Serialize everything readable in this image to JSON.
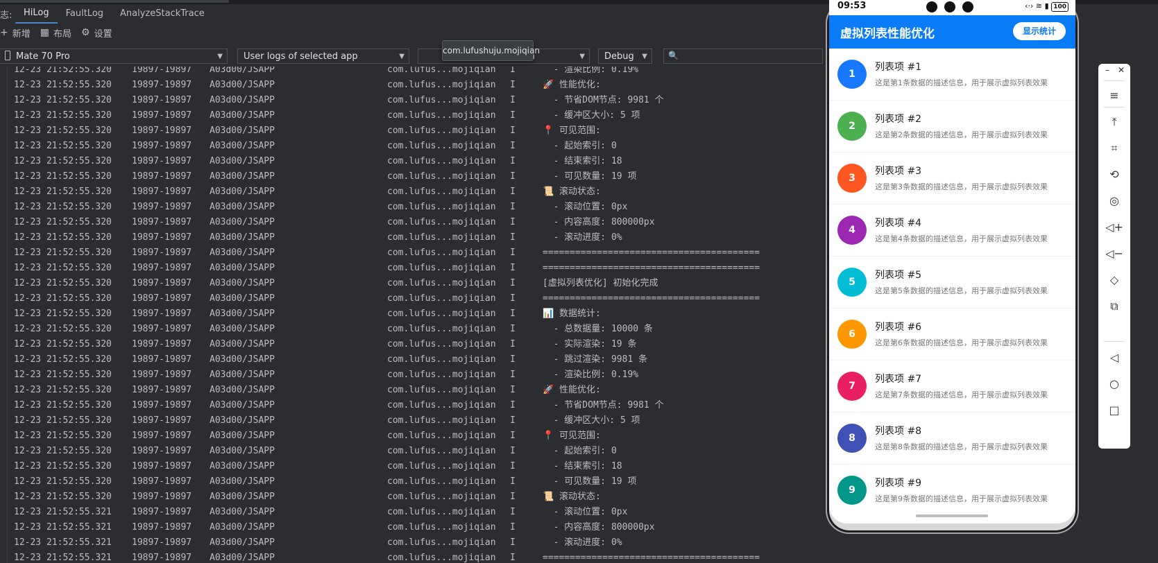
{
  "tabs": {
    "prefix": "志:",
    "items": [
      {
        "label": "HiLog",
        "active": true
      },
      {
        "label": "FaultLog",
        "active": false
      },
      {
        "label": "AnalyzeStackTrace",
        "active": false
      }
    ]
  },
  "toolbar": {
    "new_label": "新增",
    "layout_label": "布局",
    "settings_label": "设置"
  },
  "filters": {
    "device": "Mate 70 Pro",
    "log_scope": "User logs of selected app",
    "package": "com.lufushuju.mojiqian",
    "package_visible": "qian",
    "level": "Debug",
    "search_placeholder": ""
  },
  "tooltip": "com.lufushuju.mojiqian",
  "log": {
    "rows": [
      {
        "time": "12-23 21:52:55.320",
        "pid": "19897-19897",
        "tag": "A03d00/JSAPP",
        "pkg": "com.lufus...mojiqian",
        "lvl": "I",
        "msg": "  - 渲染比例: 0.19%"
      },
      {
        "time": "12-23 21:52:55.320",
        "pid": "19897-19897",
        "tag": "A03d00/JSAPP",
        "pkg": "com.lufus...mojiqian",
        "lvl": "I",
        "msg": "🚀 性能优化:"
      },
      {
        "time": "12-23 21:52:55.320",
        "pid": "19897-19897",
        "tag": "A03d00/JSAPP",
        "pkg": "com.lufus...mojiqian",
        "lvl": "I",
        "msg": "  - 节省DOM节点: 9981 个"
      },
      {
        "time": "12-23 21:52:55.320",
        "pid": "19897-19897",
        "tag": "A03d00/JSAPP",
        "pkg": "com.lufus...mojiqian",
        "lvl": "I",
        "msg": "  - 缓冲区大小: 5 项"
      },
      {
        "time": "12-23 21:52:55.320",
        "pid": "19897-19897",
        "tag": "A03d00/JSAPP",
        "pkg": "com.lufus...mojiqian",
        "lvl": "I",
        "msg": "📍 可见范围:"
      },
      {
        "time": "12-23 21:52:55.320",
        "pid": "19897-19897",
        "tag": "A03d00/JSAPP",
        "pkg": "com.lufus...mojiqian",
        "lvl": "I",
        "msg": "  - 起始索引: 0"
      },
      {
        "time": "12-23 21:52:55.320",
        "pid": "19897-19897",
        "tag": "A03d00/JSAPP",
        "pkg": "com.lufus...mojiqian",
        "lvl": "I",
        "msg": "  - 结束索引: 18"
      },
      {
        "time": "12-23 21:52:55.320",
        "pid": "19897-19897",
        "tag": "A03d00/JSAPP",
        "pkg": "com.lufus...mojiqian",
        "lvl": "I",
        "msg": "  - 可见数量: 19 项"
      },
      {
        "time": "12-23 21:52:55.320",
        "pid": "19897-19897",
        "tag": "A03d00/JSAPP",
        "pkg": "com.lufus...mojiqian",
        "lvl": "I",
        "msg": "📜 滚动状态:"
      },
      {
        "time": "12-23 21:52:55.320",
        "pid": "19897-19897",
        "tag": "A03d00/JSAPP",
        "pkg": "com.lufus...mojiqian",
        "lvl": "I",
        "msg": "  - 滚动位置: 0px"
      },
      {
        "time": "12-23 21:52:55.320",
        "pid": "19897-19897",
        "tag": "A03d00/JSAPP",
        "pkg": "com.lufus...mojiqian",
        "lvl": "I",
        "msg": "  - 内容高度: 800000px"
      },
      {
        "time": "12-23 21:52:55.320",
        "pid": "19897-19897",
        "tag": "A03d00/JSAPP",
        "pkg": "com.lufus...mojiqian",
        "lvl": "I",
        "msg": "  - 滚动进度: 0%"
      },
      {
        "time": "12-23 21:52:55.320",
        "pid": "19897-19897",
        "tag": "A03d00/JSAPP",
        "pkg": "com.lufus...mojiqian",
        "lvl": "I",
        "msg": "========================================"
      },
      {
        "time": "12-23 21:52:55.320",
        "pid": "19897-19897",
        "tag": "A03d00/JSAPP",
        "pkg": "com.lufus...mojiqian",
        "lvl": "I",
        "msg": "========================================"
      },
      {
        "time": "12-23 21:52:55.320",
        "pid": "19897-19897",
        "tag": "A03d00/JSAPP",
        "pkg": "com.lufus...mojiqian",
        "lvl": "I",
        "msg": "[虚拟列表优化] 初始化完成"
      },
      {
        "time": "12-23 21:52:55.320",
        "pid": "19897-19897",
        "tag": "A03d00/JSAPP",
        "pkg": "com.lufus...mojiqian",
        "lvl": "I",
        "msg": "========================================"
      },
      {
        "time": "12-23 21:52:55.320",
        "pid": "19897-19897",
        "tag": "A03d00/JSAPP",
        "pkg": "com.lufus...mojiqian",
        "lvl": "I",
        "msg": "📊 数据统计:"
      },
      {
        "time": "12-23 21:52:55.320",
        "pid": "19897-19897",
        "tag": "A03d00/JSAPP",
        "pkg": "com.lufus...mojiqian",
        "lvl": "I",
        "msg": "  - 总数据量: 10000 条"
      },
      {
        "time": "12-23 21:52:55.320",
        "pid": "19897-19897",
        "tag": "A03d00/JSAPP",
        "pkg": "com.lufus...mojiqian",
        "lvl": "I",
        "msg": "  - 实际渲染: 19 条"
      },
      {
        "time": "12-23 21:52:55.320",
        "pid": "19897-19897",
        "tag": "A03d00/JSAPP",
        "pkg": "com.lufus...mojiqian",
        "lvl": "I",
        "msg": "  - 跳过渲染: 9981 条"
      },
      {
        "time": "12-23 21:52:55.320",
        "pid": "19897-19897",
        "tag": "A03d00/JSAPP",
        "pkg": "com.lufus...mojiqian",
        "lvl": "I",
        "msg": "  - 渲染比例: 0.19%"
      },
      {
        "time": "12-23 21:52:55.320",
        "pid": "19897-19897",
        "tag": "A03d00/JSAPP",
        "pkg": "com.lufus...mojiqian",
        "lvl": "I",
        "msg": "🚀 性能优化:"
      },
      {
        "time": "12-23 21:52:55.320",
        "pid": "19897-19897",
        "tag": "A03d00/JSAPP",
        "pkg": "com.lufus...mojiqian",
        "lvl": "I",
        "msg": "  - 节省DOM节点: 9981 个"
      },
      {
        "time": "12-23 21:52:55.320",
        "pid": "19897-19897",
        "tag": "A03d00/JSAPP",
        "pkg": "com.lufus...mojiqian",
        "lvl": "I",
        "msg": "  - 缓冲区大小: 5 项"
      },
      {
        "time": "12-23 21:52:55.320",
        "pid": "19897-19897",
        "tag": "A03d00/JSAPP",
        "pkg": "com.lufus...mojiqian",
        "lvl": "I",
        "msg": "📍 可见范围:"
      },
      {
        "time": "12-23 21:52:55.320",
        "pid": "19897-19897",
        "tag": "A03d00/JSAPP",
        "pkg": "com.lufus...mojiqian",
        "lvl": "I",
        "msg": "  - 起始索引: 0"
      },
      {
        "time": "12-23 21:52:55.320",
        "pid": "19897-19897",
        "tag": "A03d00/JSAPP",
        "pkg": "com.lufus...mojiqian",
        "lvl": "I",
        "msg": "  - 结束索引: 18"
      },
      {
        "time": "12-23 21:52:55.320",
        "pid": "19897-19897",
        "tag": "A03d00/JSAPP",
        "pkg": "com.lufus...mojiqian",
        "lvl": "I",
        "msg": "  - 可见数量: 19 项"
      },
      {
        "time": "12-23 21:52:55.320",
        "pid": "19897-19897",
        "tag": "A03d00/JSAPP",
        "pkg": "com.lufus...mojiqian",
        "lvl": "I",
        "msg": "📜 滚动状态:"
      },
      {
        "time": "12-23 21:52:55.321",
        "pid": "19897-19897",
        "tag": "A03d00/JSAPP",
        "pkg": "com.lufus...mojiqian",
        "lvl": "I",
        "msg": "  - 滚动位置: 0px"
      },
      {
        "time": "12-23 21:52:55.321",
        "pid": "19897-19897",
        "tag": "A03d00/JSAPP",
        "pkg": "com.lufus...mojiqian",
        "lvl": "I",
        "msg": "  - 内容高度: 800000px"
      },
      {
        "time": "12-23 21:52:55.321",
        "pid": "19897-19897",
        "tag": "A03d00/JSAPP",
        "pkg": "com.lufus...mojiqian",
        "lvl": "I",
        "msg": "  - 滚动进度: 0%"
      },
      {
        "time": "12-23 21:52:55.321",
        "pid": "19897-19897",
        "tag": "A03d00/JSAPP",
        "pkg": "com.lufus...mojiqian",
        "lvl": "I",
        "msg": "========================================"
      }
    ]
  },
  "phone": {
    "status_time": "09:53",
    "battery": "100",
    "app_title": "虚拟列表性能优化",
    "stats_button": "显示统计",
    "items": [
      {
        "num": "1",
        "title": "列表项 #1",
        "desc": "这是第1条数据的描述信息，用于展示虚拟列表效果",
        "color": "#1677ff"
      },
      {
        "num": "2",
        "title": "列表项 #2",
        "desc": "这是第2条数据的描述信息，用于展示虚拟列表效果",
        "color": "#4caf50"
      },
      {
        "num": "3",
        "title": "列表项 #3",
        "desc": "这是第3条数据的描述信息，用于展示虚拟列表效果",
        "color": "#ff5722"
      },
      {
        "num": "4",
        "title": "列表项 #4",
        "desc": "这是第4条数据的描述信息，用于展示虚拟列表效果",
        "color": "#9c27b0"
      },
      {
        "num": "5",
        "title": "列表项 #5",
        "desc": "这是第5条数据的描述信息，用于展示虚拟列表效果",
        "color": "#00bcd4"
      },
      {
        "num": "6",
        "title": "列表项 #6",
        "desc": "这是第6条数据的描述信息，用于展示虚拟列表效果",
        "color": "#ff9800"
      },
      {
        "num": "7",
        "title": "列表项 #7",
        "desc": "这是第7条数据的描述信息，用于展示虚拟列表效果",
        "color": "#e91e63"
      },
      {
        "num": "8",
        "title": "列表项 #8",
        "desc": "这是第8条数据的描述信息，用于展示虚拟列表效果",
        "color": "#3f51b5"
      },
      {
        "num": "9",
        "title": "列表项 #9",
        "desc": "这是第9条数据的描述信息，用于展示虚拟列表效果",
        "color": "#009688"
      }
    ]
  },
  "side_panel": {
    "icons": [
      "minimize-icon",
      "close-icon",
      "menu-icon",
      "pin-top-icon",
      "crop-icon",
      "rotate-icon",
      "screenshot-icon",
      "volume-up-icon",
      "volume-down-icon",
      "shake-icon",
      "copy-screen-icon",
      "back-icon",
      "home-icon",
      "recents-icon"
    ]
  }
}
